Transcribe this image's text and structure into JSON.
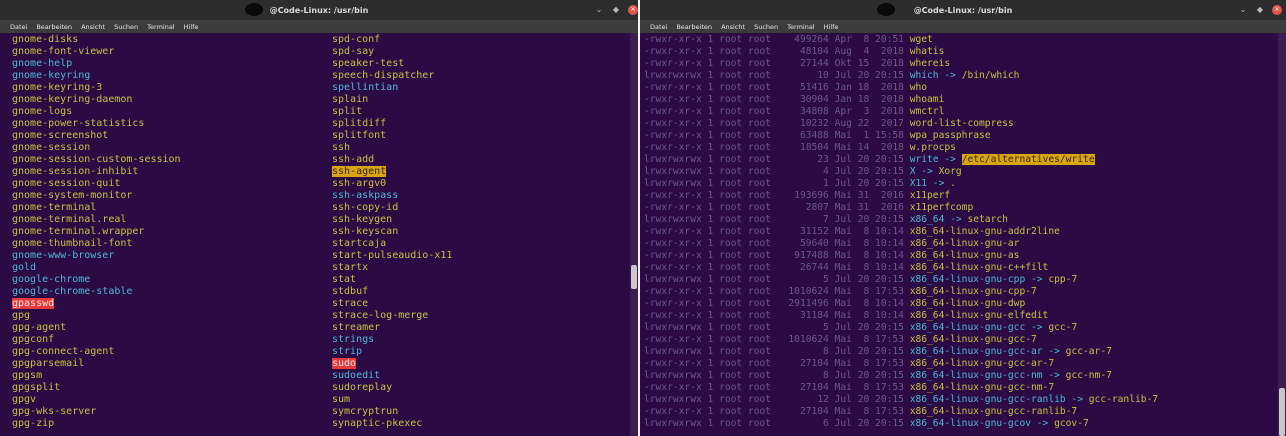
{
  "windows": [
    {
      "title": "@Code-Linux: /usr/bin",
      "menu": [
        "Datei",
        "Bearbeiten",
        "Ansicht",
        "Suchen",
        "Terminal",
        "Hilfe"
      ],
      "columns": [
        [
          {
            "t": "gnome-disks",
            "c": "yellow"
          },
          {
            "t": "gnome-font-viewer",
            "c": "yellow"
          },
          {
            "t": "gnome-help",
            "c": "cyan"
          },
          {
            "t": "gnome-keyring",
            "c": "cyan"
          },
          {
            "t": "gnome-keyring-3",
            "c": "yellow"
          },
          {
            "t": "gnome-keyring-daemon",
            "c": "yellow"
          },
          {
            "t": "gnome-logs",
            "c": "yellow"
          },
          {
            "t": "gnome-power-statistics",
            "c": "yellow"
          },
          {
            "t": "gnome-screenshot",
            "c": "yellow"
          },
          {
            "t": "gnome-session",
            "c": "yellow"
          },
          {
            "t": "gnome-session-custom-session",
            "c": "yellow"
          },
          {
            "t": "gnome-session-inhibit",
            "c": "yellow"
          },
          {
            "t": "gnome-session-quit",
            "c": "yellow"
          },
          {
            "t": "gnome-system-monitor",
            "c": "yellow"
          },
          {
            "t": "gnome-terminal",
            "c": "yellow"
          },
          {
            "t": "gnome-terminal.real",
            "c": "yellow"
          },
          {
            "t": "gnome-terminal.wrapper",
            "c": "yellow"
          },
          {
            "t": "gnome-thumbnail-font",
            "c": "yellow"
          },
          {
            "t": "gnome-www-browser",
            "c": "cyan"
          },
          {
            "t": "gold",
            "c": "cyan"
          },
          {
            "t": "google-chrome",
            "c": "cyan"
          },
          {
            "t": "google-chrome-stable",
            "c": "cyan"
          },
          {
            "t": "gpasswd",
            "c": "hl-red"
          },
          {
            "t": "gpg",
            "c": "yellow"
          },
          {
            "t": "gpg-agent",
            "c": "yellow"
          },
          {
            "t": "gpgconf",
            "c": "yellow"
          },
          {
            "t": "gpg-connect-agent",
            "c": "yellow"
          },
          {
            "t": "gpgparsemail",
            "c": "yellow"
          },
          {
            "t": "gpgsm",
            "c": "yellow"
          },
          {
            "t": "gpgsplit",
            "c": "yellow"
          },
          {
            "t": "gpgv",
            "c": "yellow"
          },
          {
            "t": "gpg-wks-server",
            "c": "yellow"
          },
          {
            "t": "gpg-zip",
            "c": "yellow"
          }
        ],
        [
          {
            "t": "spd-conf",
            "c": "yellow"
          },
          {
            "t": "spd-say",
            "c": "yellow"
          },
          {
            "t": "speaker-test",
            "c": "yellow"
          },
          {
            "t": "speech-dispatcher",
            "c": "yellow"
          },
          {
            "t": "spellintian",
            "c": "cyan"
          },
          {
            "t": "splain",
            "c": "yellow"
          },
          {
            "t": "split",
            "c": "yellow"
          },
          {
            "t": "splitdiff",
            "c": "yellow"
          },
          {
            "t": "splitfont",
            "c": "yellow"
          },
          {
            "t": "ssh",
            "c": "yellow"
          },
          {
            "t": "ssh-add",
            "c": "yellow"
          },
          {
            "t": "ssh-agent",
            "c": "hl-yel"
          },
          {
            "t": "ssh-argv0",
            "c": "yellow"
          },
          {
            "t": "ssh-askpass",
            "c": "cyan"
          },
          {
            "t": "ssh-copy-id",
            "c": "yellow"
          },
          {
            "t": "ssh-keygen",
            "c": "yellow"
          },
          {
            "t": "ssh-keyscan",
            "c": "yellow"
          },
          {
            "t": "startcaja",
            "c": "yellow"
          },
          {
            "t": "start-pulseaudio-x11",
            "c": "yellow"
          },
          {
            "t": "startx",
            "c": "yellow"
          },
          {
            "t": "stat",
            "c": "yellow"
          },
          {
            "t": "stdbuf",
            "c": "yellow"
          },
          {
            "t": "strace",
            "c": "yellow"
          },
          {
            "t": "strace-log-merge",
            "c": "yellow"
          },
          {
            "t": "streamer",
            "c": "yellow"
          },
          {
            "t": "strings",
            "c": "cyan"
          },
          {
            "t": "strip",
            "c": "cyan"
          },
          {
            "t": "sudo",
            "c": "hl-red"
          },
          {
            "t": "sudoedit",
            "c": "cyan"
          },
          {
            "t": "sudoreplay",
            "c": "yellow"
          },
          {
            "t": "sum",
            "c": "yellow"
          },
          {
            "t": "symcryptrun",
            "c": "yellow"
          },
          {
            "t": "synaptic-pkexec",
            "c": "yellow"
          }
        ]
      ]
    },
    {
      "title": "@Code-Linux: /usr/bin",
      "menu": [
        "Datei",
        "Bearbeiten",
        "Ansicht",
        "Suchen",
        "Terminal",
        "Hilfe"
      ],
      "rows": [
        {
          "meta": "-rwxr-xr-x 1 root root    499264 Apr  8 20:51 ",
          "name": "wget",
          "c": "yellow"
        },
        {
          "meta": "-rwxr-xr-x 1 root root     48104 Aug  4  2018 ",
          "name": "whatis",
          "c": "yellow"
        },
        {
          "meta": "-rwxr-xr-x 1 root root     27144 Okt 15  2018 ",
          "name": "whereis",
          "c": "yellow"
        },
        {
          "meta": "lrwxrwxrwx 1 root root        10 Jul 20 20:15 ",
          "name": "which",
          "c": "cyan",
          "target": "/bin/which",
          "tc": "yellow"
        },
        {
          "meta": "-rwxr-xr-x 1 root root     51416 Jan 18  2018 ",
          "name": "who",
          "c": "yellow"
        },
        {
          "meta": "-rwxr-xr-x 1 root root     30904 Jan 18  2018 ",
          "name": "whoami",
          "c": "yellow"
        },
        {
          "meta": "-rwxr-xr-x 1 root root     34808 Apr  3  2018 ",
          "name": "wmctrl",
          "c": "yellow"
        },
        {
          "meta": "-rwxr-xr-x 1 root root     10232 Aug 22  2017 ",
          "name": "word-list-compress",
          "c": "yellow"
        },
        {
          "meta": "-rwxr-xr-x 1 root root     63488 Mai  1 15:58 ",
          "name": "wpa_passphrase",
          "c": "yellow"
        },
        {
          "meta": "-rwxr-xr-x 1 root root     18504 Mai 14  2018 ",
          "name": "w.procps",
          "c": "yellow"
        },
        {
          "meta": "lrwxrwxrwx 1 root root        23 Jul 20 20:15 ",
          "name": "write",
          "c": "cyan",
          "target": "/etc/alternatives/write",
          "tc": "hl-yel"
        },
        {
          "meta": "lrwxrwxrwx 1 root root         4 Jul 20 20:15 ",
          "name": "X",
          "c": "cyan",
          "target": "Xorg",
          "tc": "yellow"
        },
        {
          "meta": "lrwxrwxrwx 1 root root         1 Jul 20 20:15 ",
          "name": "X11",
          "c": "cyan",
          "target": ".",
          "tc": "yellow"
        },
        {
          "meta": "-rwxr-xr-x 1 root root    193696 Mai 31  2016 ",
          "name": "x11perf",
          "c": "yellow"
        },
        {
          "meta": "-rwxr-xr-x 1 root root      2807 Mai 31  2016 ",
          "name": "x11perfcomp",
          "c": "yellow"
        },
        {
          "meta": "lrwxrwxrwx 1 root root         7 Jul 20 20:15 ",
          "name": "x86_64",
          "c": "cyan",
          "target": "setarch",
          "tc": "yellow"
        },
        {
          "meta": "-rwxr-xr-x 1 root root     31152 Mai  8 10:14 ",
          "name": "x86_64-linux-gnu-addr2line",
          "c": "yellow"
        },
        {
          "meta": "-rwxr-xr-x 1 root root     59640 Mai  8 10:14 ",
          "name": "x86_64-linux-gnu-ar",
          "c": "yellow"
        },
        {
          "meta": "-rwxr-xr-x 1 root root    917488 Mai  8 10:14 ",
          "name": "x86_64-linux-gnu-as",
          "c": "yellow"
        },
        {
          "meta": "-rwxr-xr-x 1 root root     26744 Mai  8 10:14 ",
          "name": "x86_64-linux-gnu-c++filt",
          "c": "yellow"
        },
        {
          "meta": "lrwxrwxrwx 1 root root         5 Jul 20 20:15 ",
          "name": "x86_64-linux-gnu-cpp",
          "c": "cyan",
          "target": "cpp-7",
          "tc": "yellow"
        },
        {
          "meta": "-rwxr-xr-x 1 root root   1010624 Mai  8 17:53 ",
          "name": "x86_64-linux-gnu-cpp-7",
          "c": "yellow"
        },
        {
          "meta": "-rwxr-xr-x 1 root root   2911496 Mai  8 10:14 ",
          "name": "x86_64-linux-gnu-dwp",
          "c": "yellow"
        },
        {
          "meta": "-rwxr-xr-x 1 root root     31184 Mai  8 10:14 ",
          "name": "x86_64-linux-gnu-elfedit",
          "c": "yellow"
        },
        {
          "meta": "lrwxrwxrwx 1 root root         5 Jul 20 20:15 ",
          "name": "x86_64-linux-gnu-gcc",
          "c": "cyan",
          "target": "gcc-7",
          "tc": "yellow"
        },
        {
          "meta": "-rwxr-xr-x 1 root root   1010624 Mai  8 17:53 ",
          "name": "x86_64-linux-gnu-gcc-7",
          "c": "yellow"
        },
        {
          "meta": "lrwxrwxrwx 1 root root         8 Jul 20 20:15 ",
          "name": "x86_64-linux-gnu-gcc-ar",
          "c": "cyan",
          "target": "gcc-ar-7",
          "tc": "yellow"
        },
        {
          "meta": "-rwxr-xr-x 1 root root     27104 Mai  8 17:53 ",
          "name": "x86_64-linux-gnu-gcc-ar-7",
          "c": "yellow"
        },
        {
          "meta": "lrwxrwxrwx 1 root root         8 Jul 20 20:15 ",
          "name": "x86_64-linux-gnu-gcc-nm",
          "c": "cyan",
          "target": "gcc-nm-7",
          "tc": "yellow"
        },
        {
          "meta": "-rwxr-xr-x 1 root root     27104 Mai  8 17:53 ",
          "name": "x86_64-linux-gnu-gcc-nm-7",
          "c": "yellow"
        },
        {
          "meta": "lrwxrwxrwx 1 root root        12 Jul 20 20:15 ",
          "name": "x86_64-linux-gnu-gcc-ranlib",
          "c": "cyan",
          "target": "gcc-ranlib-7",
          "tc": "yellow"
        },
        {
          "meta": "-rwxr-xr-x 1 root root     27104 Mai  8 17:53 ",
          "name": "x86_64-linux-gnu-gcc-ranlib-7",
          "c": "yellow"
        },
        {
          "meta": "lrwxrwxrwx 1 root root         6 Jul 20 20:15 ",
          "name": "x86_64-linux-gnu-gcov",
          "c": "cyan",
          "target": "gcov-7",
          "tc": "yellow"
        }
      ]
    }
  ],
  "symlink_arrow": "->",
  "colors": {
    "background": "#2c0a44",
    "cyan": "#4fb8d6",
    "yellow": "#c9c241",
    "highlight_red": "#e63a3a",
    "highlight_yellow": "#d9a512"
  },
  "icons": {
    "minimize": "chevron-down-icon",
    "maximize": "maximize-icon",
    "close": "close-icon"
  }
}
